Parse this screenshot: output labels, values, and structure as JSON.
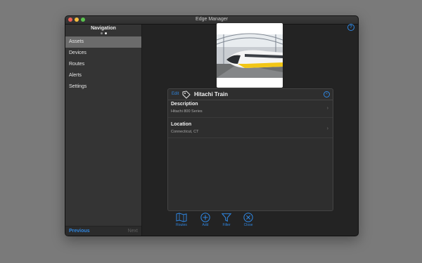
{
  "window": {
    "title": "Edge Manager"
  },
  "sidebar": {
    "title": "Navigation",
    "items": [
      {
        "label": "Assets",
        "selected": true
      },
      {
        "label": "Devices"
      },
      {
        "label": "Routes"
      },
      {
        "label": "Alerts"
      },
      {
        "label": "Settings"
      }
    ],
    "footer": {
      "previous": "Previous",
      "next": "Next"
    }
  },
  "asset": {
    "edit_label": "Edit",
    "name": "Hitachi Train",
    "description_label": "Description",
    "description_value": "Hitachi 800 Series",
    "location_label": "Location",
    "location_value": "Connecticut, CT"
  },
  "toolbar": {
    "routes": "Routes",
    "add": "Add",
    "filter": "Filter",
    "close": "Close"
  },
  "colors": {
    "accent": "#2f86e0",
    "background": "#232323",
    "sidebar": "#343434",
    "selected": "#6b6b6b"
  }
}
